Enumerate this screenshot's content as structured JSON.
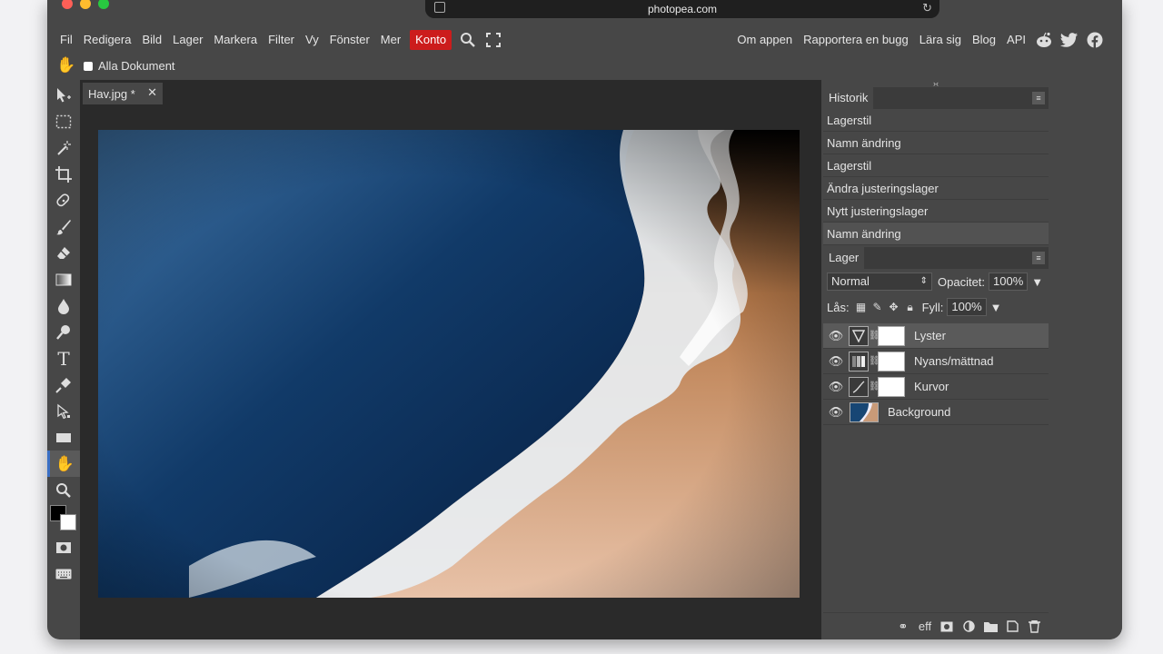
{
  "browser": {
    "url": "photopea.com"
  },
  "menu": {
    "items": [
      "Fil",
      "Redigera",
      "Bild",
      "Lager",
      "Markera",
      "Filter",
      "Vy",
      "Fönster",
      "Mer"
    ],
    "account": "Konto",
    "right": [
      "Om appen",
      "Rapportera en bugg",
      "Lära sig",
      "Blog",
      "API"
    ]
  },
  "options": {
    "all_documents": "Alla Dokument"
  },
  "document": {
    "tab": "Hav.jpg *"
  },
  "history": {
    "title": "Historik",
    "items": [
      "Lagerstil",
      "Namn ändring",
      "Lagerstil",
      "Ändra justeringslager",
      "Nytt justeringslager",
      "Namn ändring"
    ]
  },
  "layers": {
    "title": "Lager",
    "blend_mode": "Normal",
    "opacity_label": "Opacitet:",
    "opacity": "100%",
    "lock_label": "Lås:",
    "fill_label": "Fyll:",
    "fill": "100%",
    "items": [
      {
        "name": "Lyster"
      },
      {
        "name": "Nyans/mättnad"
      },
      {
        "name": "Kurvor"
      },
      {
        "name": "Background"
      }
    ]
  },
  "footer_icons": [
    "link-icon",
    "effects-icon",
    "mask-icon",
    "adjustment-icon",
    "folder-icon",
    "new-layer-icon",
    "trash-icon"
  ],
  "footer_effects_label": "eff"
}
